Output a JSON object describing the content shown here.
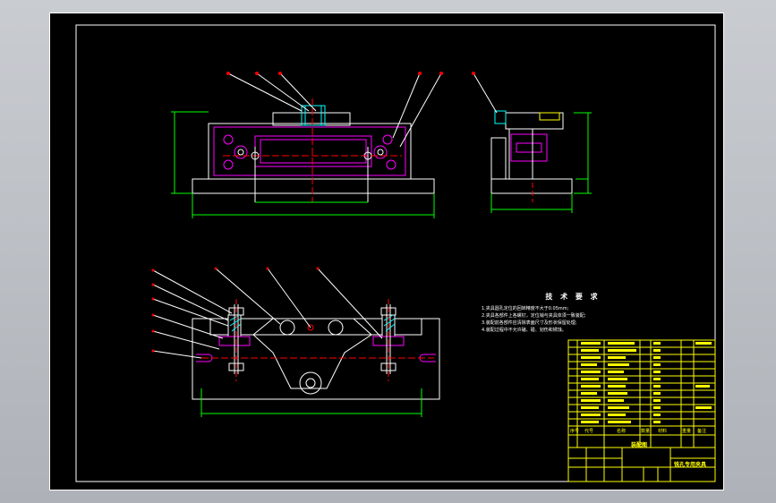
{
  "tech_requirements": {
    "title": "技 术 要 求",
    "items": [
      "1.夹具圆孔定位的回转精度不大于0.05mm;",
      "2.夹具各部件上各螺钉，定位销与夹具体须一致装配;",
      "3.装配前各部件应清除表面尺寸及形状保留处理;",
      "4.装配过程中不允许磕、碰、划伤和锈蚀。"
    ]
  },
  "title_block": {
    "drawing_name": "铣孔专用夹具",
    "label_assembly": "装配图",
    "col_seq": "序号",
    "col_code": "代号",
    "col_name": "名称",
    "col_qty": "数量",
    "col_material": "材料",
    "col_weight": "重量",
    "col_remark": "备注"
  },
  "colors": {
    "sheet": "#000000",
    "outline": "#ffffff",
    "dimension": "#00ff00",
    "part": "#ff00ff",
    "centerline": "#ff0000",
    "leader": "#ffffff",
    "table": "#ffff00",
    "hatch": "#00ffff"
  }
}
